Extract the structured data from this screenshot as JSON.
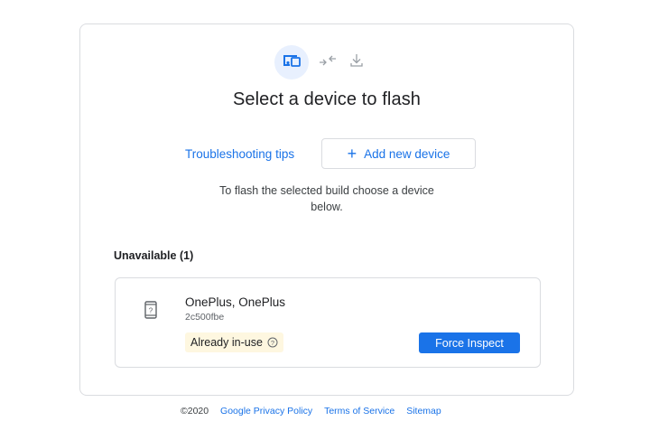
{
  "header": {
    "steps": [
      {
        "icon": "devices-icon",
        "active": true
      },
      {
        "icon": "connect-arrows-icon",
        "active": false
      },
      {
        "icon": "download-icon",
        "active": false
      }
    ],
    "title": "Select a device to flash"
  },
  "actions": {
    "troubleshooting_label": "Troubleshooting tips",
    "add_device_label": "Add new device",
    "add_device_icon": "plus-icon"
  },
  "hint": "To flash the selected build choose a device below.",
  "unavailable": {
    "label": "Unavailable (1)",
    "devices": [
      {
        "name": "OnePlus, OnePlus",
        "serial": "2c500fbe",
        "icon": "phone-unknown-icon",
        "status": "Already in-use",
        "status_icon": "help-circle-icon",
        "action_label": "Force Inspect"
      }
    ]
  },
  "footer": {
    "copyright": "©2020",
    "links": [
      "Google Privacy Policy",
      "Terms of Service",
      "Sitemap"
    ]
  },
  "colors": {
    "accent": "#1a73e8",
    "active_step_bg": "#e8f0fe",
    "badge_bg": "#fef7e0",
    "border": "#dadce0"
  }
}
